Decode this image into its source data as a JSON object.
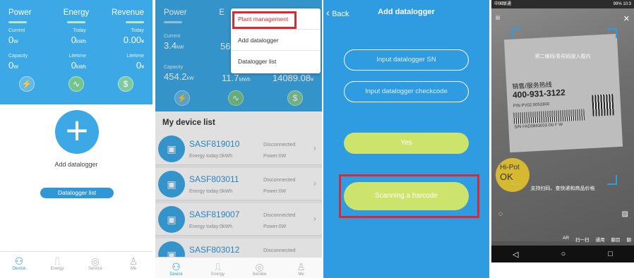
{
  "screen1": {
    "tabs": [
      "Power",
      "Energy",
      "Revenue"
    ],
    "stats_row1": [
      {
        "label": "Current",
        "value": "0",
        "unit": "W"
      },
      {
        "label": "Today",
        "value": "0",
        "unit": "kWh"
      },
      {
        "label": "Today",
        "value": "0.00",
        "unit": "¥"
      }
    ],
    "stats_row2": [
      {
        "label": "Capacity",
        "value": "0",
        "unit": "W"
      },
      {
        "label": "Lifetime",
        "value": "0",
        "unit": "kWh"
      },
      {
        "label": "Lifetime",
        "value": "0",
        "unit": "¥"
      }
    ],
    "add_label": "Add datalogger",
    "list_button": "Datalogger list",
    "nav": [
      "Device",
      "Energy",
      "Service",
      "Me"
    ]
  },
  "screen2": {
    "tabs": [
      "Power",
      "E"
    ],
    "stats_row1": [
      {
        "label": "Current",
        "value": "3.4",
        "unit": "kW"
      },
      {
        "label": "",
        "value": "56",
        "unit": ""
      }
    ],
    "stats_row2": [
      {
        "label": "Capacity",
        "value": "454.2",
        "unit": "kW"
      },
      {
        "label": "",
        "value": "11.7",
        "unit": "MWh"
      },
      {
        "label": "",
        "value": "14089.08",
        "unit": "¥"
      }
    ],
    "menu": [
      "Plant management",
      "Add datalogger",
      "Datalogger list"
    ],
    "list_title": "My device list",
    "devices": [
      {
        "name": "SASF819010",
        "status": "Disconnected",
        "energy": "Energy today:0kWh",
        "power": "Power:0W"
      },
      {
        "name": "SASF803011",
        "status": "Disconnected",
        "energy": "Energy today:0kWh",
        "power": "Power:0W"
      },
      {
        "name": "SASF819007",
        "status": "Disconnected",
        "energy": "Energy today:0kWh",
        "power": "Power:0W"
      },
      {
        "name": "SASF803012",
        "status": "Disconnected",
        "energy": "",
        "power": ""
      }
    ],
    "nav": [
      "Device",
      "Energy",
      "Service",
      "Me"
    ]
  },
  "screen3": {
    "back": "Back",
    "title": "Add datalogger",
    "input_sn": "Input datalogger SN",
    "input_code": "Input datalogger checkcode",
    "yes": "Yes",
    "scan": "Scanning a barcode"
  },
  "screen4": {
    "status_left": "中国联通",
    "status_right": "99% 10:3",
    "hint": "将二维码/条形码放入框内",
    "label_line1": "销售/服务热线",
    "label_line2": "400-931-3122",
    "label_pn": "P/N PV02.0051800",
    "label_sn": "S/N FAD0843003  D0  F W",
    "sticker_top": "Hi-Pot",
    "sticker_bottom": "OK",
    "hint2": "支持扫码、查快递和商品价格",
    "tabs": [
      "AR",
      "扫一扫",
      "通用",
      "翻目",
      "翻"
    ]
  },
  "colors": {
    "blue": "#3ca9e6",
    "highlight": "#e0262e",
    "green_button": "#cde46c"
  }
}
